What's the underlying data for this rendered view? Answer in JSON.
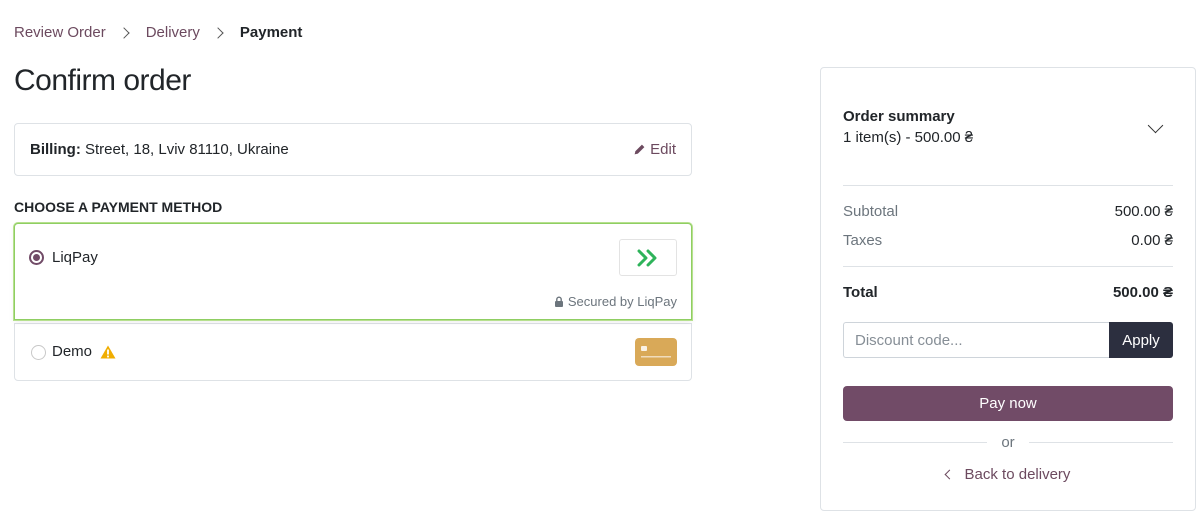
{
  "breadcrumb": {
    "items": [
      "Review Order",
      "Delivery"
    ],
    "active": "Payment"
  },
  "page": {
    "title": "Confirm order"
  },
  "billing": {
    "label": "Billing:",
    "address": "Street, 18, Lviv 81110, Ukraine",
    "edit_label": "Edit",
    "edit_icon": "pencil-icon"
  },
  "payment": {
    "section_title": "CHOOSE A PAYMENT METHOD",
    "methods": [
      {
        "label": "LiqPay",
        "selected": true,
        "secured_text": "Secured by LiqPay",
        "logo_icon": "liqpay-logo",
        "accent": "#2eb35a"
      },
      {
        "label": "Demo",
        "selected": false,
        "warning_icon": "warning-icon",
        "card_icon": "card-icon",
        "card_color": "#d9a958"
      }
    ]
  },
  "summary": {
    "title": "Order summary",
    "items_text": "1 item(s) -  500.00 ₴",
    "subtotal_label": "Subtotal",
    "subtotal_value": "500.00 ₴",
    "taxes_label": "Taxes",
    "taxes_value": "0.00 ₴",
    "total_label": "Total",
    "total_value": "500.00 ₴",
    "discount_placeholder": "Discount code...",
    "apply_label": "Apply",
    "pay_label": "Pay now",
    "or_text": "or",
    "back_label": "Back to delivery"
  },
  "colors": {
    "brand": "#714b67",
    "link": "#6c4a5f",
    "apply_bg": "#2c2f3f",
    "selected_border": "#8fce62",
    "warning": "#f0ad00"
  }
}
